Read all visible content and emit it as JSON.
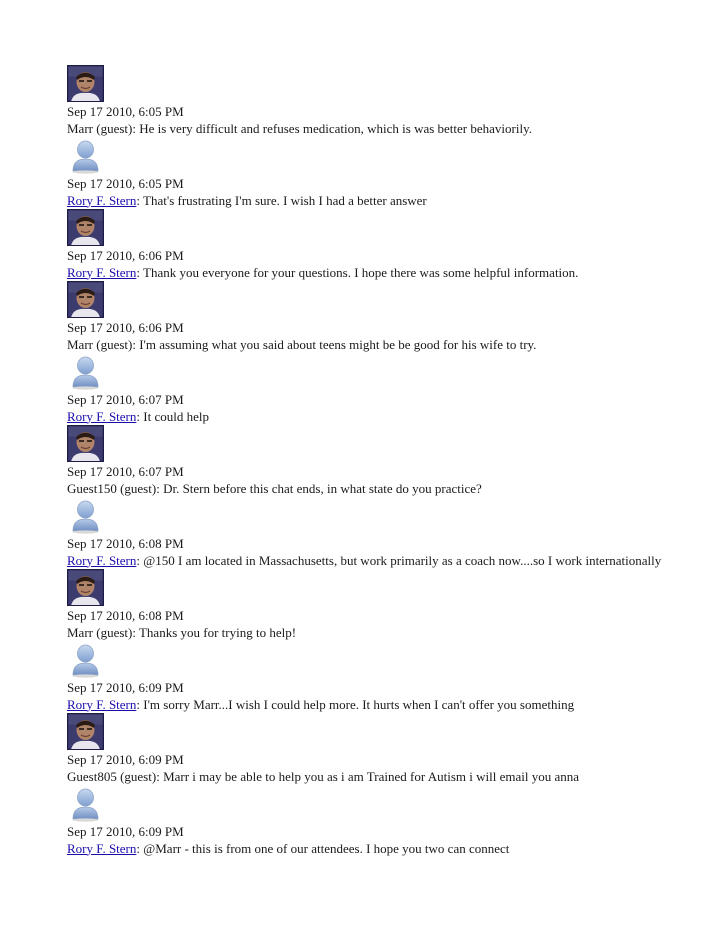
{
  "messages": [
    {
      "avatar": "host-photo",
      "timestamp": "Sep 17 2010, 6:05 PM",
      "author": "Marr (guest)",
      "author_link": false,
      "text": "He is very difficult and refuses medication, which is was better behaviorily."
    },
    {
      "avatar": "guest-silhouette",
      "timestamp": "Sep 17 2010, 6:05 PM",
      "author": "Rory F. Stern",
      "author_link": true,
      "text": "That's frustrating I'm sure. I wish I had a better answer"
    },
    {
      "avatar": "host-photo",
      "timestamp": "Sep 17 2010, 6:06 PM",
      "author": "Rory F. Stern",
      "author_link": true,
      "text": "Thank you everyone for your questions. I hope there was some helpful information."
    },
    {
      "avatar": "host-photo",
      "timestamp": "Sep 17 2010, 6:06 PM",
      "author": "Marr (guest)",
      "author_link": false,
      "text": "I'm assuming what you said about teens might be be good for his wife to try."
    },
    {
      "avatar": "guest-silhouette",
      "timestamp": "Sep 17 2010, 6:07 PM",
      "author": "Rory F. Stern",
      "author_link": true,
      "text": "It could help"
    },
    {
      "avatar": "host-photo",
      "timestamp": "Sep 17 2010, 6:07 PM",
      "author": "Guest150 (guest)",
      "author_link": false,
      "text": "Dr. Stern before this chat ends, in what state do you practice?"
    },
    {
      "avatar": "guest-silhouette",
      "timestamp": "Sep 17 2010, 6:08 PM",
      "author": "Rory F. Stern",
      "author_link": true,
      "text": "@150 I am located in Massachusetts, but work primarily as a coach now....so I work internationally"
    },
    {
      "avatar": "host-photo",
      "timestamp": "Sep 17 2010, 6:08 PM",
      "author": "Marr (guest)",
      "author_link": false,
      "text": "Thanks you for trying to help!"
    },
    {
      "avatar": "guest-silhouette",
      "timestamp": "Sep 17 2010, 6:09 PM",
      "author": "Rory F. Stern",
      "author_link": true,
      "text": "I'm sorry Marr...I wish I could help more. It hurts when I can't offer you something"
    },
    {
      "avatar": "host-photo",
      "timestamp": "Sep 17 2010, 6:09 PM",
      "author": "Guest805 (guest)",
      "author_link": false,
      "text": "Marr i may be able to help you as i am Trained for Autism i will email you anna"
    },
    {
      "avatar": "guest-silhouette",
      "timestamp": "Sep 17 2010, 6:09 PM",
      "author": "Rory F. Stern",
      "author_link": true,
      "text": "@Marr - this is from one of our attendees. I hope you two can connect"
    }
  ],
  "separator": ": "
}
